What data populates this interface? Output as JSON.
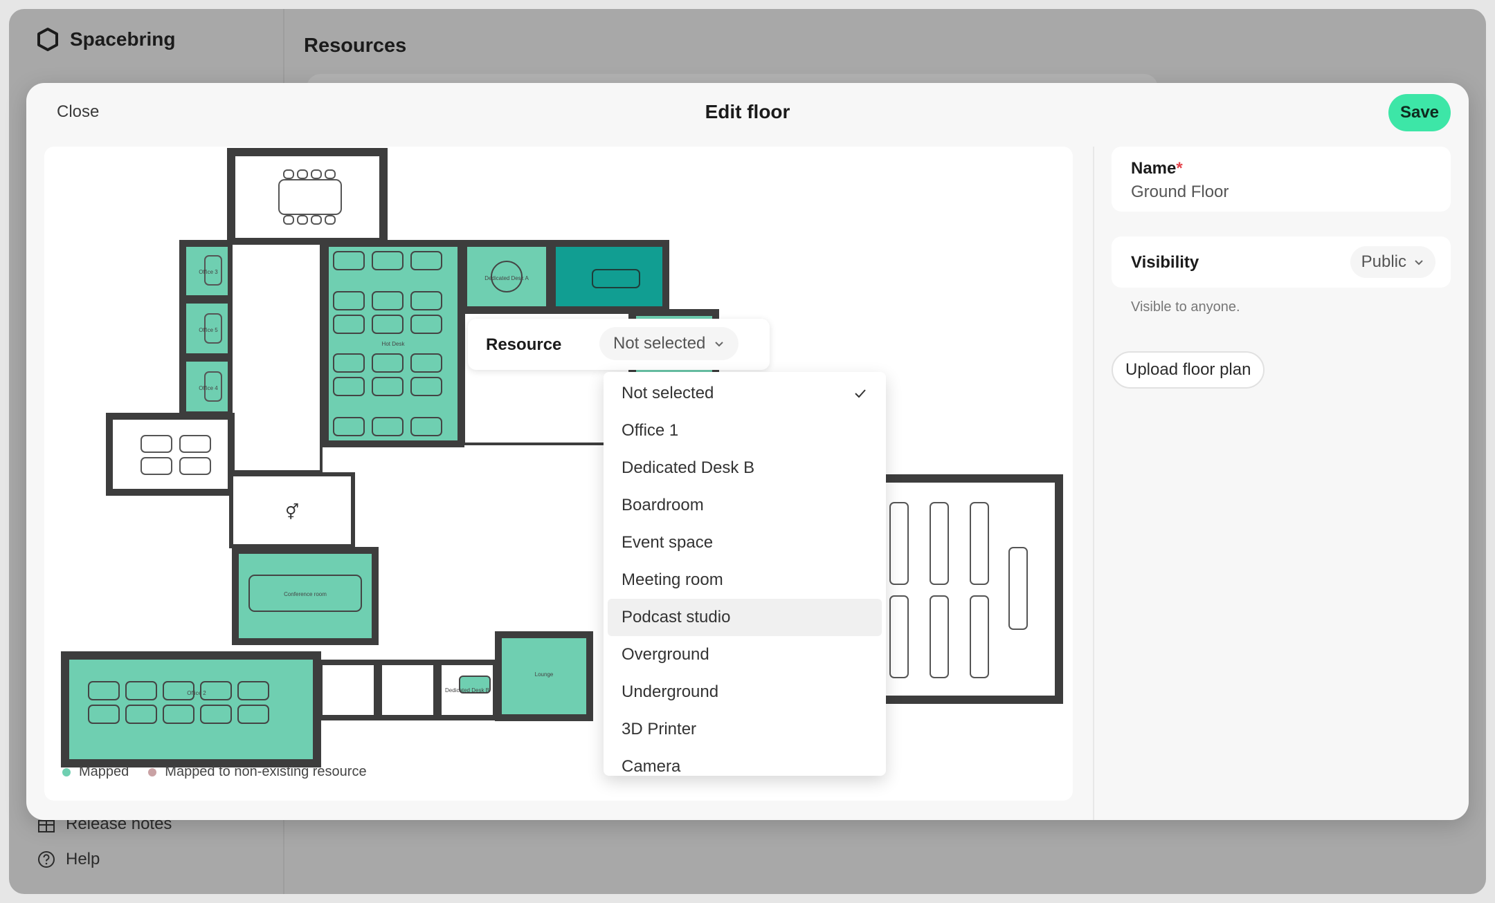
{
  "app": {
    "brand": "Spacebring",
    "page_title": "Resources"
  },
  "sidebar_bottom": [
    {
      "label": "Release notes",
      "icon": "gift-icon"
    },
    {
      "label": "Help",
      "icon": "help-circle-icon"
    }
  ],
  "modal": {
    "close_label": "Close",
    "title": "Edit floor",
    "save_label": "Save"
  },
  "floor_plan": {
    "room_labels": {
      "office3": "Office 3",
      "office5": "Office 5",
      "office4": "Office 4",
      "dedicated_a": "Dedicated Desk A",
      "hot_desk": "Hot Desk",
      "conference": "Conference room",
      "office2": "Office 2",
      "dedicated_b": "Dedicated Desk B",
      "lounge": "Lounge"
    },
    "colors": {
      "mapped": "#6fcfb1",
      "selected": "#119e92",
      "unmapped": "#c9a2a4",
      "wall": "#3d3d3d"
    }
  },
  "legend": {
    "mapped_label": "Mapped",
    "unmapped_label": "Mapped to non-existing resource"
  },
  "resource_popover": {
    "label": "Resource",
    "selected": "Not selected"
  },
  "dropdown": {
    "options": [
      {
        "label": "Not selected",
        "checked": true
      },
      {
        "label": "Office 1"
      },
      {
        "label": "Dedicated Desk B"
      },
      {
        "label": "Boardroom"
      },
      {
        "label": "Event space"
      },
      {
        "label": "Meeting room"
      },
      {
        "label": "Podcast studio",
        "highlighted": true
      },
      {
        "label": "Overground"
      },
      {
        "label": "Underground"
      },
      {
        "label": "3D Printer"
      },
      {
        "label": "Camera"
      }
    ]
  },
  "panel": {
    "name_label": "Name",
    "name_required": "*",
    "name_value": "Ground Floor",
    "visibility_label": "Visibility",
    "visibility_value": "Public",
    "visibility_hint": "Visible to anyone.",
    "upload_label": "Upload floor plan"
  }
}
